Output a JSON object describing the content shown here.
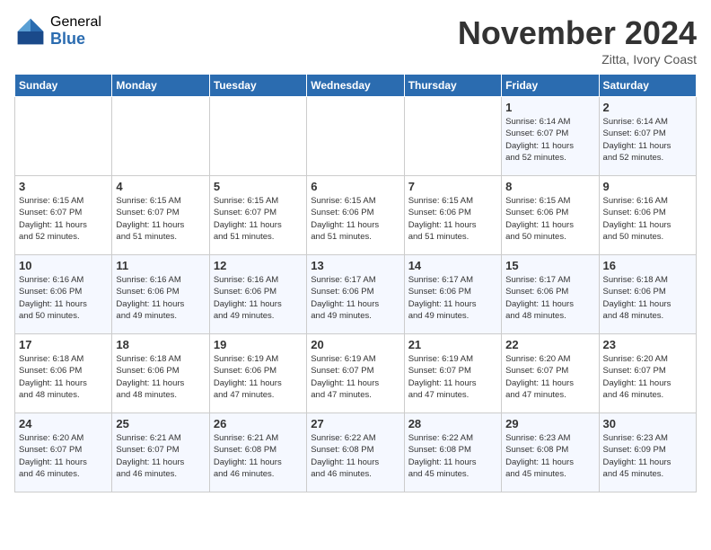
{
  "header": {
    "logo_general": "General",
    "logo_blue": "Blue",
    "month_title": "November 2024",
    "location": "Zitta, Ivory Coast"
  },
  "weekdays": [
    "Sunday",
    "Monday",
    "Tuesday",
    "Wednesday",
    "Thursday",
    "Friday",
    "Saturday"
  ],
  "weeks": [
    [
      {
        "day": "",
        "info": ""
      },
      {
        "day": "",
        "info": ""
      },
      {
        "day": "",
        "info": ""
      },
      {
        "day": "",
        "info": ""
      },
      {
        "day": "",
        "info": ""
      },
      {
        "day": "1",
        "info": "Sunrise: 6:14 AM\nSunset: 6:07 PM\nDaylight: 11 hours\nand 52 minutes."
      },
      {
        "day": "2",
        "info": "Sunrise: 6:14 AM\nSunset: 6:07 PM\nDaylight: 11 hours\nand 52 minutes."
      }
    ],
    [
      {
        "day": "3",
        "info": "Sunrise: 6:15 AM\nSunset: 6:07 PM\nDaylight: 11 hours\nand 52 minutes."
      },
      {
        "day": "4",
        "info": "Sunrise: 6:15 AM\nSunset: 6:07 PM\nDaylight: 11 hours\nand 51 minutes."
      },
      {
        "day": "5",
        "info": "Sunrise: 6:15 AM\nSunset: 6:07 PM\nDaylight: 11 hours\nand 51 minutes."
      },
      {
        "day": "6",
        "info": "Sunrise: 6:15 AM\nSunset: 6:06 PM\nDaylight: 11 hours\nand 51 minutes."
      },
      {
        "day": "7",
        "info": "Sunrise: 6:15 AM\nSunset: 6:06 PM\nDaylight: 11 hours\nand 51 minutes."
      },
      {
        "day": "8",
        "info": "Sunrise: 6:15 AM\nSunset: 6:06 PM\nDaylight: 11 hours\nand 50 minutes."
      },
      {
        "day": "9",
        "info": "Sunrise: 6:16 AM\nSunset: 6:06 PM\nDaylight: 11 hours\nand 50 minutes."
      }
    ],
    [
      {
        "day": "10",
        "info": "Sunrise: 6:16 AM\nSunset: 6:06 PM\nDaylight: 11 hours\nand 50 minutes."
      },
      {
        "day": "11",
        "info": "Sunrise: 6:16 AM\nSunset: 6:06 PM\nDaylight: 11 hours\nand 49 minutes."
      },
      {
        "day": "12",
        "info": "Sunrise: 6:16 AM\nSunset: 6:06 PM\nDaylight: 11 hours\nand 49 minutes."
      },
      {
        "day": "13",
        "info": "Sunrise: 6:17 AM\nSunset: 6:06 PM\nDaylight: 11 hours\nand 49 minutes."
      },
      {
        "day": "14",
        "info": "Sunrise: 6:17 AM\nSunset: 6:06 PM\nDaylight: 11 hours\nand 49 minutes."
      },
      {
        "day": "15",
        "info": "Sunrise: 6:17 AM\nSunset: 6:06 PM\nDaylight: 11 hours\nand 48 minutes."
      },
      {
        "day": "16",
        "info": "Sunrise: 6:18 AM\nSunset: 6:06 PM\nDaylight: 11 hours\nand 48 minutes."
      }
    ],
    [
      {
        "day": "17",
        "info": "Sunrise: 6:18 AM\nSunset: 6:06 PM\nDaylight: 11 hours\nand 48 minutes."
      },
      {
        "day": "18",
        "info": "Sunrise: 6:18 AM\nSunset: 6:06 PM\nDaylight: 11 hours\nand 48 minutes."
      },
      {
        "day": "19",
        "info": "Sunrise: 6:19 AM\nSunset: 6:06 PM\nDaylight: 11 hours\nand 47 minutes."
      },
      {
        "day": "20",
        "info": "Sunrise: 6:19 AM\nSunset: 6:07 PM\nDaylight: 11 hours\nand 47 minutes."
      },
      {
        "day": "21",
        "info": "Sunrise: 6:19 AM\nSunset: 6:07 PM\nDaylight: 11 hours\nand 47 minutes."
      },
      {
        "day": "22",
        "info": "Sunrise: 6:20 AM\nSunset: 6:07 PM\nDaylight: 11 hours\nand 47 minutes."
      },
      {
        "day": "23",
        "info": "Sunrise: 6:20 AM\nSunset: 6:07 PM\nDaylight: 11 hours\nand 46 minutes."
      }
    ],
    [
      {
        "day": "24",
        "info": "Sunrise: 6:20 AM\nSunset: 6:07 PM\nDaylight: 11 hours\nand 46 minutes."
      },
      {
        "day": "25",
        "info": "Sunrise: 6:21 AM\nSunset: 6:07 PM\nDaylight: 11 hours\nand 46 minutes."
      },
      {
        "day": "26",
        "info": "Sunrise: 6:21 AM\nSunset: 6:08 PM\nDaylight: 11 hours\nand 46 minutes."
      },
      {
        "day": "27",
        "info": "Sunrise: 6:22 AM\nSunset: 6:08 PM\nDaylight: 11 hours\nand 46 minutes."
      },
      {
        "day": "28",
        "info": "Sunrise: 6:22 AM\nSunset: 6:08 PM\nDaylight: 11 hours\nand 45 minutes."
      },
      {
        "day": "29",
        "info": "Sunrise: 6:23 AM\nSunset: 6:08 PM\nDaylight: 11 hours\nand 45 minutes."
      },
      {
        "day": "30",
        "info": "Sunrise: 6:23 AM\nSunset: 6:09 PM\nDaylight: 11 hours\nand 45 minutes."
      }
    ]
  ]
}
